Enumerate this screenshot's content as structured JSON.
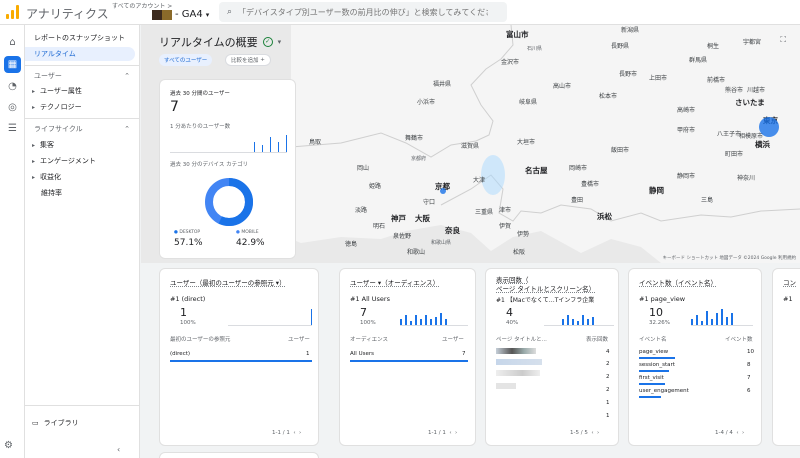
{
  "header": {
    "app_title": "アナリティクス",
    "account_breadcrumb": "すべてのアカウント >",
    "property": "- GA4",
    "search_placeholder": "「デバイスタイプ別ユーザー数の前月比の伸び」と検索してみてください"
  },
  "nav": {
    "snapshot": "レポートのスナップショット",
    "realtime": "リアルタイム",
    "user_section": "ユーザー",
    "user_items": [
      "ユーザー属性",
      "テクノロジー"
    ],
    "lifecycle_section": "ライフサイクル",
    "lifecycle_items": [
      "集客",
      "エンゲージメント",
      "収益化",
      "維持率"
    ],
    "library": "ライブラリ"
  },
  "page": {
    "title": "リアルタイムの概要",
    "chip_all": "すべてのユーザー",
    "chip_compare": "比較を追加"
  },
  "map": {
    "cities": [
      "富山市",
      "石川県",
      "金沢市",
      "福井県",
      "小浜市",
      "岐阜県",
      "長野県",
      "新潟県",
      "群馬県",
      "前橋市",
      "さいたま",
      "東京",
      "横浜",
      "鳥取",
      "姫路",
      "神戸",
      "大阪",
      "京都",
      "明石",
      "和歌山",
      "名古屋",
      "豊田",
      "静岡",
      "浜松",
      "岡山",
      "奈良",
      "岡崎市",
      "豊橋市",
      "甲府市",
      "長野市",
      "高崎市",
      "松本市",
      "町田市",
      "宇都宮",
      "熊谷市",
      "京都府",
      "滋賀県",
      "三重県",
      "大津",
      "和歌山県",
      "徳島",
      "淡路",
      "守口",
      "泉佐野",
      "舞鶴市",
      "八王子市",
      "大垣市",
      "津市",
      "伊勢",
      "静岡市",
      "相模原市",
      "三島",
      "神奈川",
      "川越市",
      "上田市",
      "桐生",
      "高山市",
      "飯田市",
      "松阪",
      "伊賀"
    ],
    "credit": "キーボード ショートカット  地図データ ©2024 Google  利用規約"
  },
  "overview": {
    "title": "過去 30 分間のユーザー",
    "value": "7",
    "per_minute": "1 分あたりのユーザー数",
    "device_title": "過去 30 分のデバイス カテゴリ",
    "desktop_label": "DESKTOP",
    "desktop_pct": "57.1%",
    "mobile_label": "MOBILE",
    "mobile_pct": "42.9%",
    "colors": {
      "desktop": "#1a73e8",
      "mobile": "#4285f4"
    }
  },
  "card_users_source": {
    "title": "ユーザー（最初のユーザーの参照元 ▾）",
    "top_label": "#1 (direct)",
    "top_value": "1",
    "top_pct": "100%",
    "col1": "最初のユーザーの参照元",
    "col2": "ユーザー",
    "rows": [
      {
        "name": "(direct)",
        "value": "1"
      }
    ],
    "pager": "1-1 / 1"
  },
  "card_audience": {
    "title": "ユーザー ▾（オーディエンス）",
    "top_label": "#1  All Users",
    "top_value": "7",
    "top_pct": "100%",
    "col1": "オーディエンス",
    "col2": "ユーザー",
    "rows": [
      {
        "name": "All Users",
        "value": "7"
      }
    ],
    "pager": "1-1 / 1"
  },
  "card_views": {
    "title_line1": "表示回数（",
    "title_line2": "ページ タイトルとスクリーン名）",
    "top_label": "#1 【Macでなくて…Tインフラ企業",
    "top_value": "4",
    "top_pct": "40%",
    "col1": "ページ タイトルと...",
    "col2": "表示回数",
    "values": [
      "4",
      "2",
      "2",
      "2",
      "1",
      "1"
    ],
    "pager": "1-5 / 5"
  },
  "card_events": {
    "title": "イベント数（イベント名）",
    "top_label": "#1  page_view",
    "top_value": "10",
    "top_pct": "32.26%",
    "col1": "イベント名",
    "col2": "イベント数",
    "rows": [
      {
        "name": "page_view",
        "value": "10"
      },
      {
        "name": "session_start",
        "value": "8"
      },
      {
        "name": "first_visit",
        "value": "7"
      },
      {
        "name": "user_engagement",
        "value": "6"
      }
    ],
    "pager": "1-4 / 4"
  },
  "card_conv": {
    "title": "コン",
    "top_label": "#1"
  }
}
